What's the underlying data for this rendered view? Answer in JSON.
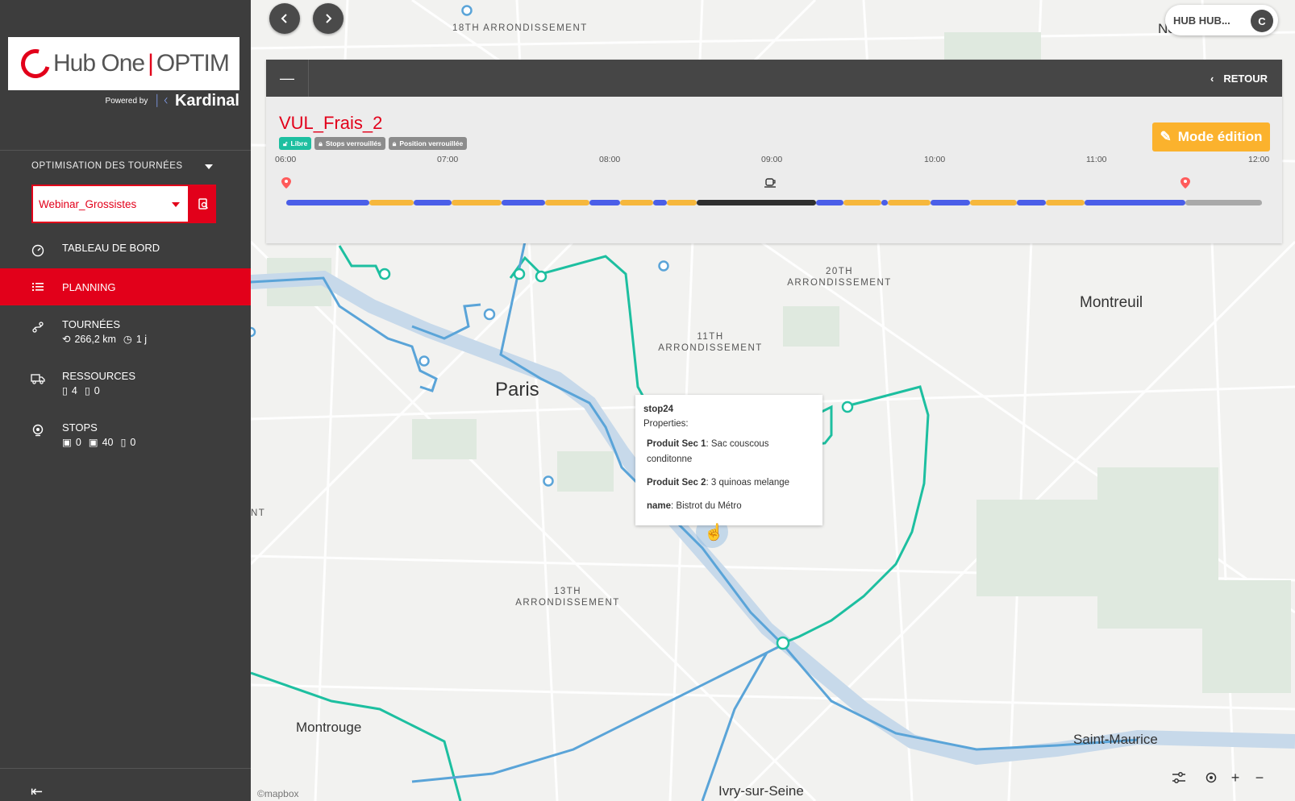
{
  "sidebar": {
    "logo": {
      "brand": "Hub One",
      "product": "OPTIM",
      "powered_by": "Powered by",
      "partner": "Kardinal"
    },
    "section_title": "OPTIMISATION DES TOURNÉES",
    "scenario": "Webinar_Grossistes",
    "nav": [
      {
        "label": "TABLEAU DE BORD"
      },
      {
        "label": "PLANNING"
      },
      {
        "label": "TOURNÉES",
        "distance": "266,2 km",
        "duration": "1 j"
      },
      {
        "label": "RESSOURCES",
        "count_a": "4",
        "count_b": "0"
      },
      {
        "label": "STOPS",
        "count_a": "0",
        "count_b": "40",
        "count_c": "0"
      }
    ],
    "collapse": "⇤"
  },
  "header": {
    "user": "HUB HUB...",
    "avatar": "C"
  },
  "panel": {
    "retour": "RETOUR",
    "vehicle": "VUL_Frais_2",
    "badges": {
      "libre": "Libre",
      "stops": "Stops verrouillés",
      "position": "Position verrouillée"
    },
    "edit": "Mode édition",
    "timeline": {
      "ticks": [
        "06:00",
        "07:00",
        "08:00",
        "09:00",
        "10:00",
        "11:00",
        "12:00"
      ],
      "colors": {
        "drive": "#4a5ee8",
        "service": "#f6b73c",
        "break": "#2f2f2f",
        "idle": "#a9a9a9",
        "marker": "#ff5b5b"
      }
    }
  },
  "map": {
    "labels": {
      "arr18": "18TH ARRONDISSEMENT",
      "arr20": "20TH ARRONDISSEMENT",
      "arr11": "11TH ARRONDISSEMENT",
      "arr13": "13TH ARRONDISSEMENT",
      "paris": "Paris",
      "montreuil": "Montreuil",
      "montrouge": "Montrouge",
      "saint_maurice": "Saint-Maurice",
      "ivry": "Ivry-sur-Seine",
      "nt": "NT",
      "no": "No",
      "mapbox": "©mapbox"
    },
    "popup": {
      "title": "stop24",
      "props": "Properties:",
      "k1": "Produit Sec 1",
      "v1": ": Sac couscous conditonne",
      "k2": "Produit Sec 2",
      "v2": ": 3 quinoas melange",
      "k3": "name",
      "v3": ": Bistrot du Métro"
    },
    "route_colors": {
      "teal": "#1dbfa0",
      "blue": "#5aa4d8",
      "river": "#c7d9ea"
    }
  }
}
